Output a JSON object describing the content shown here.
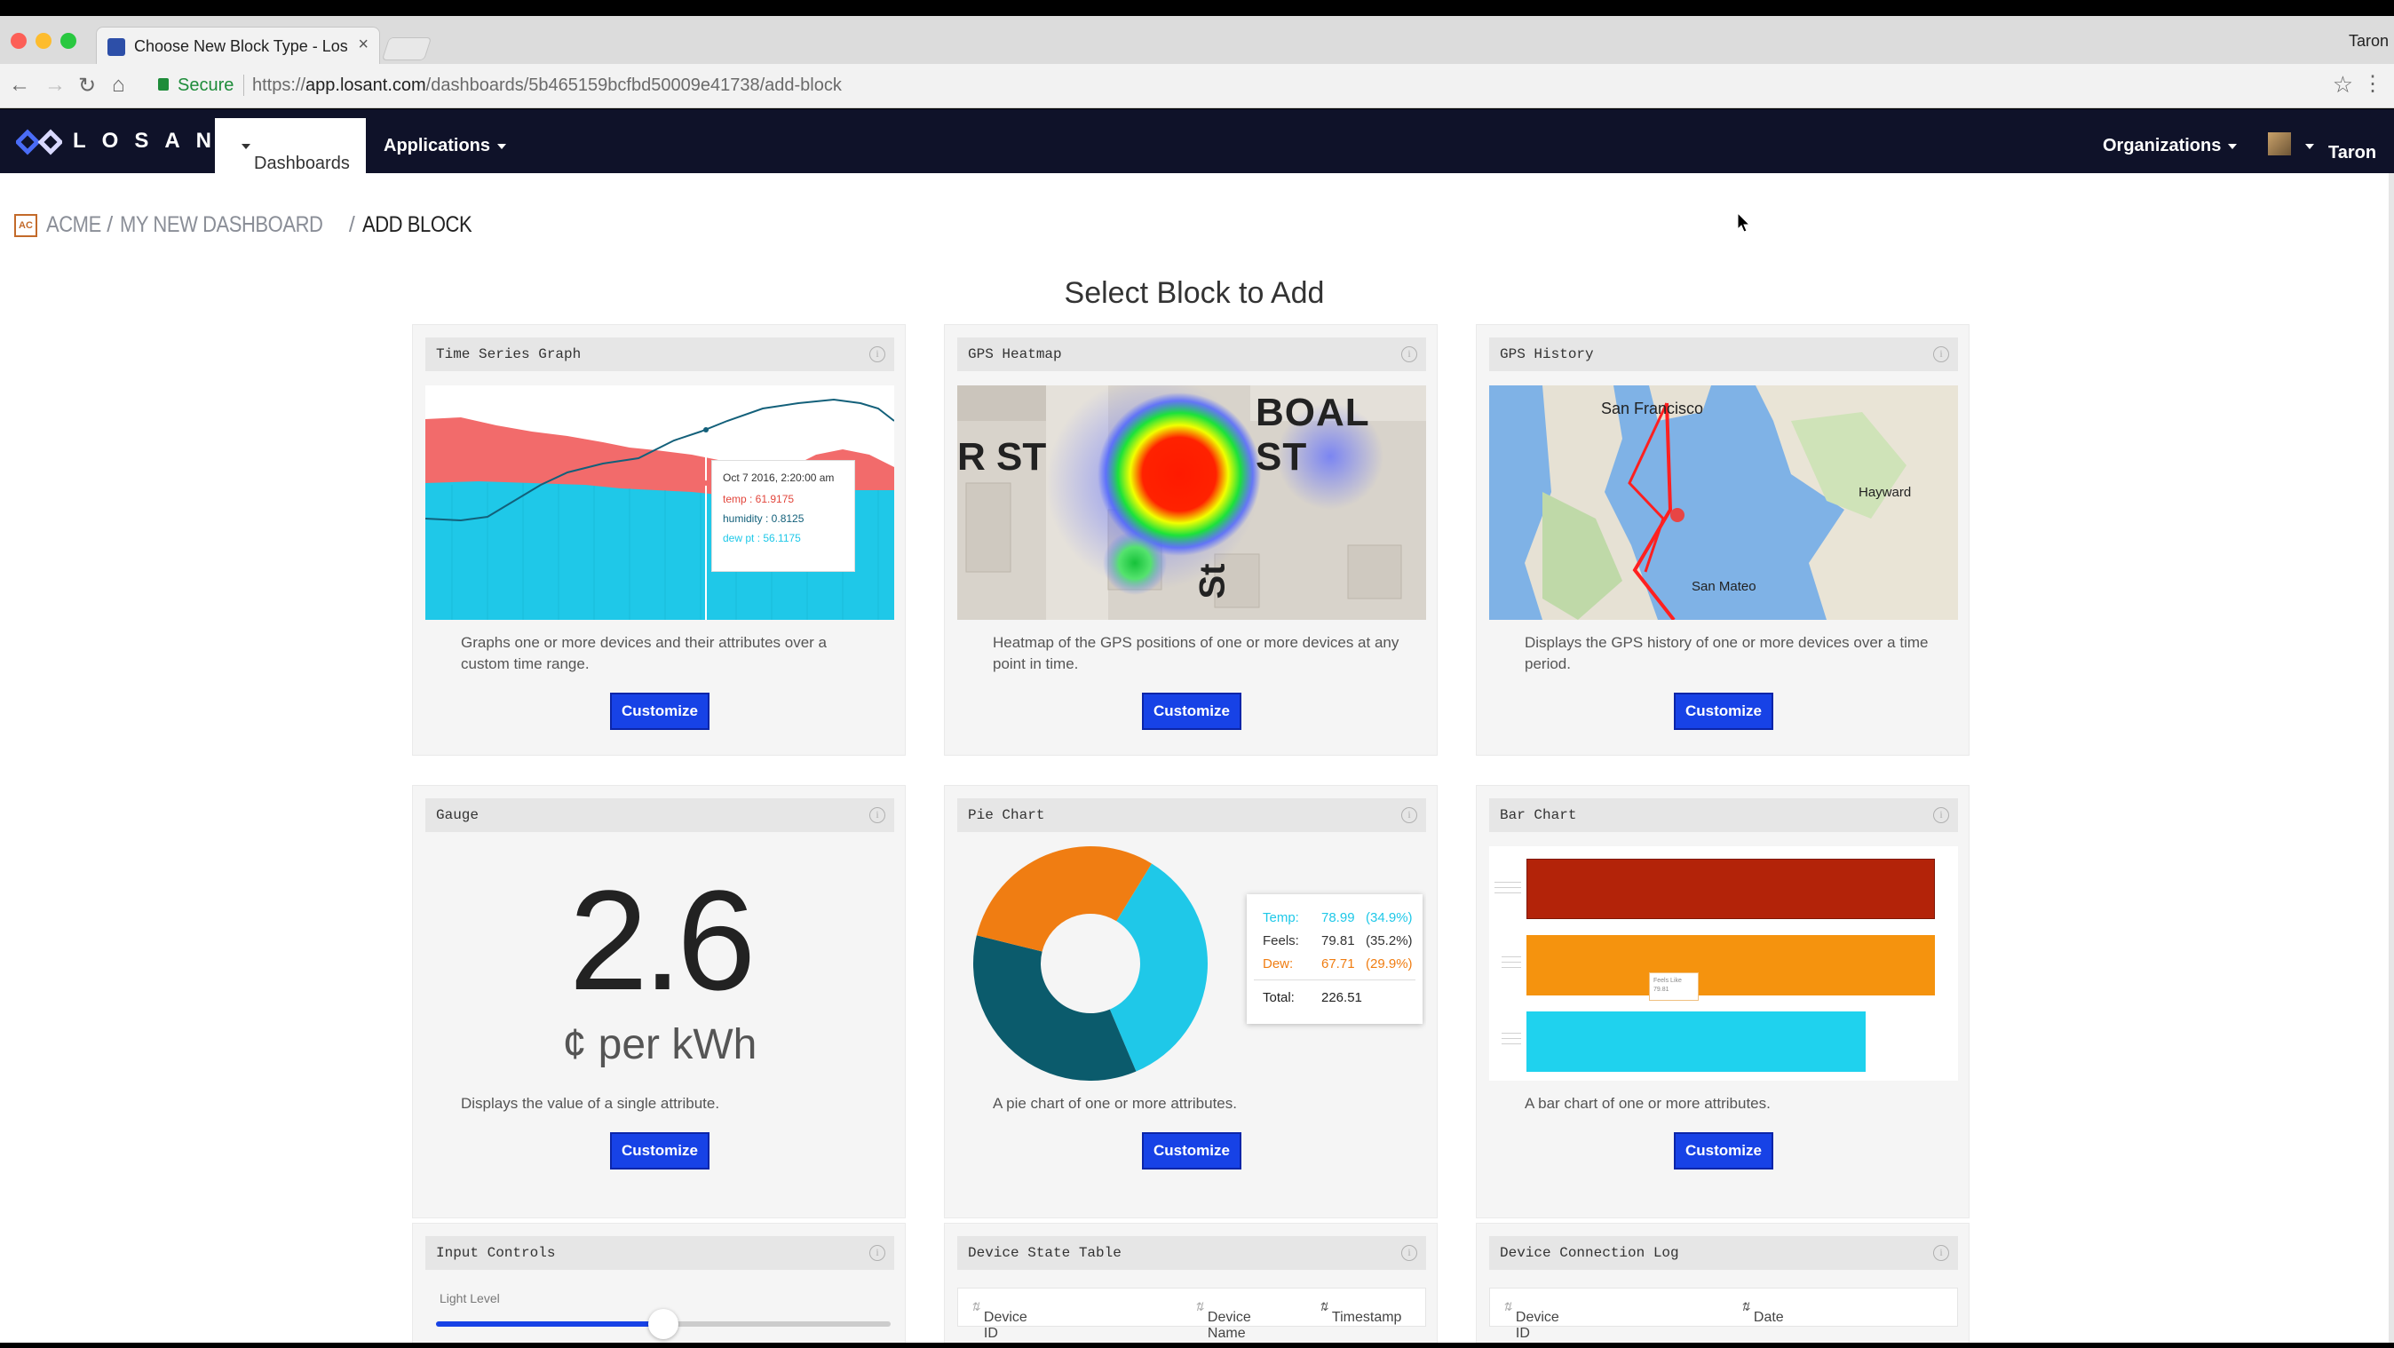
{
  "browser": {
    "tab_title": "Choose New Block Type - Losant",
    "profile_name": "Taron",
    "secure_label": "Secure",
    "url_prefix": "https://",
    "url_host": "app.losant.com",
    "url_path": "/dashboards/5b465159bcfbd50009e41738/add-block"
  },
  "nav": {
    "logo_text": "LOSANT",
    "dashboards": "Dashboards",
    "applications": "Applications",
    "organizations": "Organizations",
    "user": "Taron"
  },
  "breadcrumb": {
    "badge": "AC",
    "items": [
      "ACME",
      "MY NEW DASHBOARD",
      "ADD BLOCK"
    ]
  },
  "heading": "Select Block to Add",
  "customize_label": "Customize",
  "cards": {
    "time_series": {
      "title": "Time Series Graph",
      "desc": "Graphs one or more devices and their attributes over a custom time range.",
      "tooltip": {
        "date": "Oct 7 2016, 2:20:00 am",
        "temp": "temp : 61.9175",
        "humidity": "humidity : 0.8125",
        "dew": "dew pt : 56.1175"
      }
    },
    "gps_heatmap": {
      "title": "GPS Heatmap",
      "desc": "Heatmap of the GPS positions of one or more devices at any point in time.",
      "street1": "BOAL ST",
      "street2": "R ST",
      "street3": "St"
    },
    "gps_history": {
      "title": "GPS History",
      "desc": "Displays the GPS history of one or more devices over a time period.",
      "city1": "San Francisco",
      "city2": "Hayward",
      "city3": "San Mateo"
    },
    "gauge": {
      "title": "Gauge",
      "desc": "Displays the value of a single attribute.",
      "value": "2.6",
      "unit": "¢ per kWh"
    },
    "pie": {
      "title": "Pie Chart",
      "desc": "A pie chart of one or more attributes.",
      "legend": [
        {
          "label": "Temp:",
          "value": "78.99",
          "pct": "(34.9%)",
          "color": "#1fc8e8"
        },
        {
          "label": "Feels:",
          "value": "79.81",
          "pct": "(35.2%)",
          "color": "#333333"
        },
        {
          "label": "Dew:",
          "value": "67.71",
          "pct": "(29.9%)",
          "color": "#f07d12"
        }
      ],
      "total_label": "Total:",
      "total_value": "226.51"
    },
    "bar": {
      "title": "Bar Chart",
      "desc": "A bar chart of one or more attributes.",
      "tooltip": "Feels Like",
      "tooltip_value": "79.81"
    },
    "input_controls": {
      "title": "Input Controls",
      "slider_label": "Light Level",
      "slider_value": 0.5
    },
    "device_state": {
      "title": "Device State Table",
      "columns": [
        "Device ID",
        "Device Name",
        "Timestamp"
      ]
    },
    "connection_log": {
      "title": "Device Connection Log",
      "columns": [
        "Device ID",
        "Date"
      ]
    }
  },
  "colors": {
    "nav_bg": "#0f1229",
    "button_bg": "#1742e6",
    "teal": "#1fc8e8",
    "salmon": "#f26b6b",
    "dark_teal": "#0b5b6c",
    "orange": "#f07d12",
    "dark_red": "#b32309"
  }
}
